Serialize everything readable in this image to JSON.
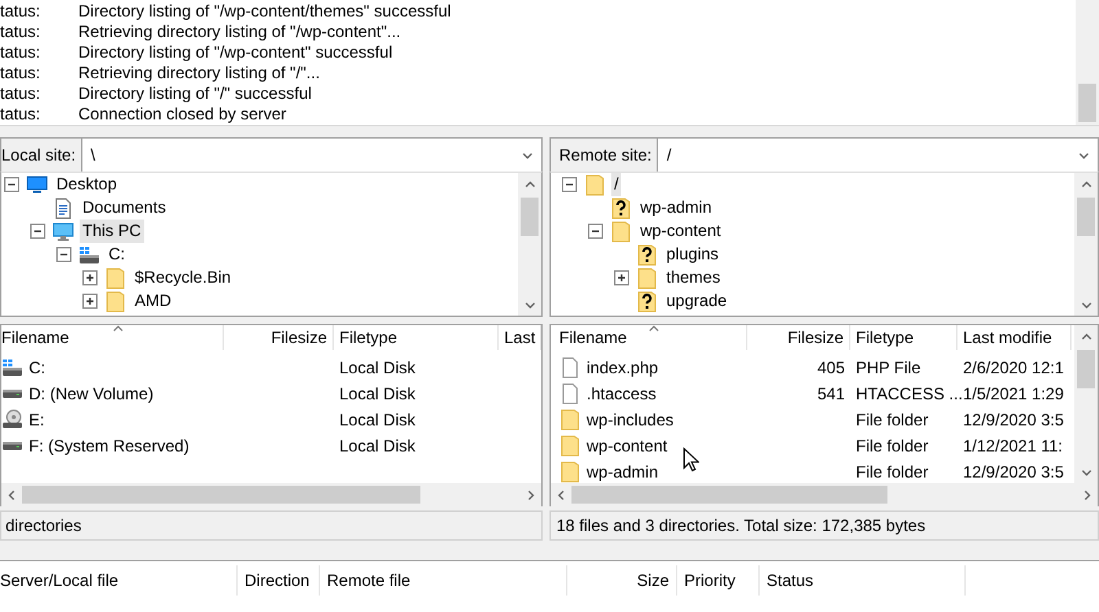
{
  "message_log": {
    "rows": [
      {
        "label": "tatus:",
        "message": "Directory listing of \"/wp-content/themes\" successful"
      },
      {
        "label": "tatus:",
        "message": "Retrieving directory listing of \"/wp-content\"..."
      },
      {
        "label": "tatus:",
        "message": "Directory listing of \"/wp-content\" successful"
      },
      {
        "label": "tatus:",
        "message": "Retrieving directory listing of \"/\"..."
      },
      {
        "label": "tatus:",
        "message": "Directory listing of \"/\" successful"
      },
      {
        "label": "tatus:",
        "message": "Connection closed by server"
      }
    ]
  },
  "local": {
    "site_label": "Local site:",
    "path": "\\",
    "tree": [
      {
        "label": "Desktop",
        "kind": "monitor",
        "expanded": true,
        "selected": false,
        "children": [
          {
            "label": "Documents",
            "kind": "document",
            "selected": false
          },
          {
            "label": "This PC",
            "kind": "computer",
            "expanded": true,
            "selected": true,
            "children": [
              {
                "label": "C:",
                "kind": "drive-windows",
                "expanded": true,
                "selected": false,
                "children": [
                  {
                    "label": "$Recycle.Bin",
                    "kind": "folder",
                    "expanded": false,
                    "selected": false
                  },
                  {
                    "label": "AMD",
                    "kind": "folder",
                    "expanded": false,
                    "selected": false
                  }
                ]
              }
            ]
          }
        ]
      }
    ],
    "columns": [
      {
        "label": "Filename",
        "sorted": true
      },
      {
        "label": "Filesize",
        "sorted": false
      },
      {
        "label": "Filetype",
        "sorted": false
      },
      {
        "label": "Last",
        "sorted": false
      }
    ],
    "rows": [
      {
        "kind": "drive-windows",
        "filename": "C:",
        "filetype": "Local Disk"
      },
      {
        "kind": "drive",
        "filename": "D: (New Volume)",
        "filetype": "Local Disk"
      },
      {
        "kind": "disc-drive",
        "filename": "E:",
        "filetype": "Local Disk"
      },
      {
        "kind": "drive",
        "filename": "F: (System Reserved)",
        "filetype": "Local Disk"
      }
    ],
    "status": "directories"
  },
  "remote": {
    "site_label": "Remote site:",
    "path": "/",
    "tree": [
      {
        "label": "/",
        "kind": "folder",
        "expanded": true,
        "selected": true,
        "children": [
          {
            "label": "wp-admin",
            "kind": "unknown-folder",
            "selected": false
          },
          {
            "label": "wp-content",
            "kind": "folder",
            "expanded": true,
            "selected": false,
            "children": [
              {
                "label": "plugins",
                "kind": "unknown-folder",
                "selected": false
              },
              {
                "label": "themes",
                "kind": "folder",
                "expanded": false,
                "selected": false
              },
              {
                "label": "upgrade",
                "kind": "unknown-folder",
                "selected": false
              }
            ]
          }
        ]
      }
    ],
    "columns": [
      {
        "label": "Filename",
        "sorted": true
      },
      {
        "label": "Filesize",
        "sorted": false
      },
      {
        "label": "Filetype",
        "sorted": false
      },
      {
        "label": "Last modifie",
        "sorted": false
      }
    ],
    "rows": [
      {
        "kind": "file",
        "filename": "index.php",
        "filesize": "405",
        "filetype": "PHP File",
        "last_modified": "2/6/2020 12:1"
      },
      {
        "kind": "file",
        "filename": ".htaccess",
        "filesize": "541",
        "filetype": "HTACCESS ...",
        "last_modified": "1/5/2021 1:29"
      },
      {
        "kind": "folder",
        "filename": "wp-includes",
        "filetype": "File folder",
        "last_modified": "12/9/2020 3:5"
      },
      {
        "kind": "folder",
        "filename": "wp-content",
        "filetype": "File folder",
        "last_modified": "1/12/2021 11:"
      },
      {
        "kind": "folder",
        "filename": "wp-admin",
        "filetype": "File folder",
        "last_modified": "12/9/2020 3:5"
      }
    ],
    "status": "18 files and 3 directories. Total size: 172,385 bytes"
  },
  "queue": {
    "columns": [
      "Server/Local file",
      "Direction",
      "Remote file",
      "Size",
      "Priority",
      "Status"
    ]
  }
}
